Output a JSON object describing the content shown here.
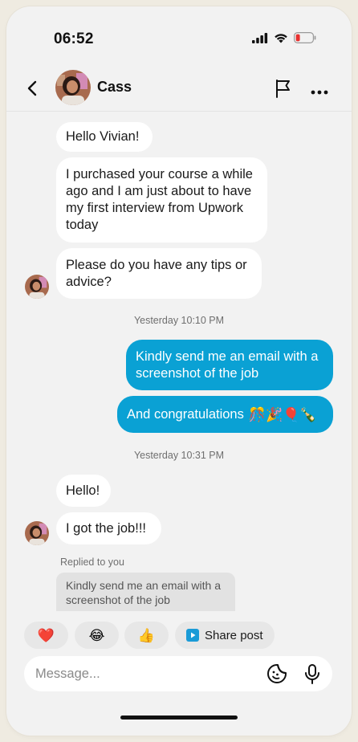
{
  "status_bar": {
    "time": "06:52"
  },
  "header": {
    "contact_name": "Cass"
  },
  "messages": [
    {
      "id": "m1",
      "direction": "in",
      "text": "Hello Vivian!"
    },
    {
      "id": "m2",
      "direction": "in",
      "text": "I purchased your course a while ago and I am just about to have my first interview from Upwork today"
    },
    {
      "id": "m3",
      "direction": "in",
      "text": "Please do you have any tips or advice?"
    },
    {
      "id": "t1",
      "type": "timestamp",
      "text": "Yesterday 10:10 PM"
    },
    {
      "id": "m4",
      "direction": "out",
      "text": "Kindly send me an email with a screenshot of the job"
    },
    {
      "id": "m5",
      "direction": "out",
      "text": "And congratulations",
      "emojis": "🎊🎉🎈🍾"
    },
    {
      "id": "t2",
      "type": "timestamp",
      "text": "Yesterday 10:31 PM"
    },
    {
      "id": "m6",
      "direction": "in",
      "text": "Hello!"
    },
    {
      "id": "m7",
      "direction": "in",
      "text": "I got the job!!!"
    }
  ],
  "reply": {
    "label": "Replied to you",
    "quoted_text": "Kindly send me an email with a screenshot of the job"
  },
  "quick_reactions": [
    {
      "name": "heart",
      "emoji": "❤️"
    },
    {
      "name": "joy",
      "emoji": "😂"
    },
    {
      "name": "thumbs-up",
      "emoji": "👍"
    }
  ],
  "share_post": {
    "label": "Share post"
  },
  "composer": {
    "placeholder": "Message..."
  },
  "colors": {
    "outgoing_bubble": "#0aa1d4",
    "incoming_bubble": "#ffffff",
    "background": "#f2f2f2",
    "page_background": "#efebe1"
  },
  "icons": {
    "back": "chevron-left-icon",
    "flag": "flag-icon",
    "more": "more-horizontal-icon",
    "sticker": "sticker-icon",
    "mic": "microphone-icon",
    "share": "play-square-icon"
  }
}
